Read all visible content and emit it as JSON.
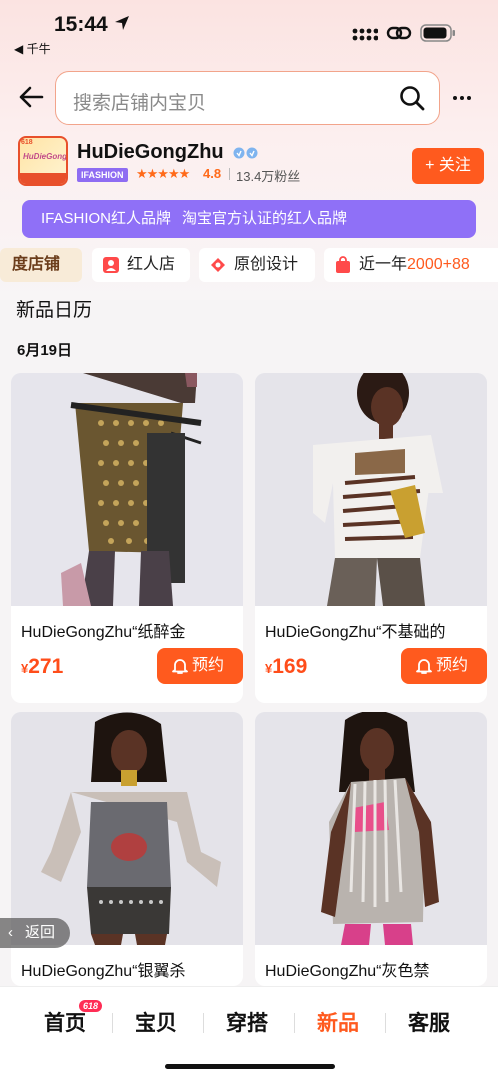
{
  "status_bar": {
    "time": "15:44",
    "back_app": "◀ 千牛"
  },
  "search": {
    "placeholder": "搜索店铺内宝贝"
  },
  "shop": {
    "logo_text": "HuDieGongZhu",
    "logo_tag": "618",
    "name": "HuDieGongZhu",
    "brand_tag": "IFASHION",
    "stars": "★★★★★",
    "rating": "4.8",
    "fans": "13.4万粉丝",
    "follow_label": "+ 关注"
  },
  "banner": {
    "title": "IFASHION红人品牌",
    "desc": "淘宝官方认证的红人品牌"
  },
  "chips": [
    {
      "label": "度店铺"
    },
    {
      "label": "红人店",
      "icon": "person-icon"
    },
    {
      "label": "原创设计",
      "icon": "design-icon"
    },
    {
      "label": "近一年",
      "highlight": "2000+88",
      "icon": "bag-icon"
    }
  ],
  "section": {
    "title": "新品日历",
    "date": "6月19日"
  },
  "products": [
    {
      "title": "HuDieGongZhu“纸醉金",
      "currency": "¥",
      "price": "271",
      "button": "预约"
    },
    {
      "title": "HuDieGongZhu“不基础的",
      "currency": "¥",
      "price": "169",
      "button": "预约"
    },
    {
      "title": "HuDieGongZhu“银翼杀",
      "currency": "",
      "price": "",
      "button": ""
    },
    {
      "title": "HuDieGongZhu“灰色禁",
      "currency": "",
      "price": "",
      "button": ""
    }
  ],
  "floating_back": "返回",
  "tabs": [
    {
      "label": "首页",
      "badge": "618"
    },
    {
      "label": "宝贝"
    },
    {
      "label": "穿搭"
    },
    {
      "label": "新品",
      "active": true
    },
    {
      "label": "客服"
    }
  ],
  "colors": {
    "accent": "#ff5a1e",
    "purple": "#8f70f7",
    "price": "#ff4d1a"
  }
}
